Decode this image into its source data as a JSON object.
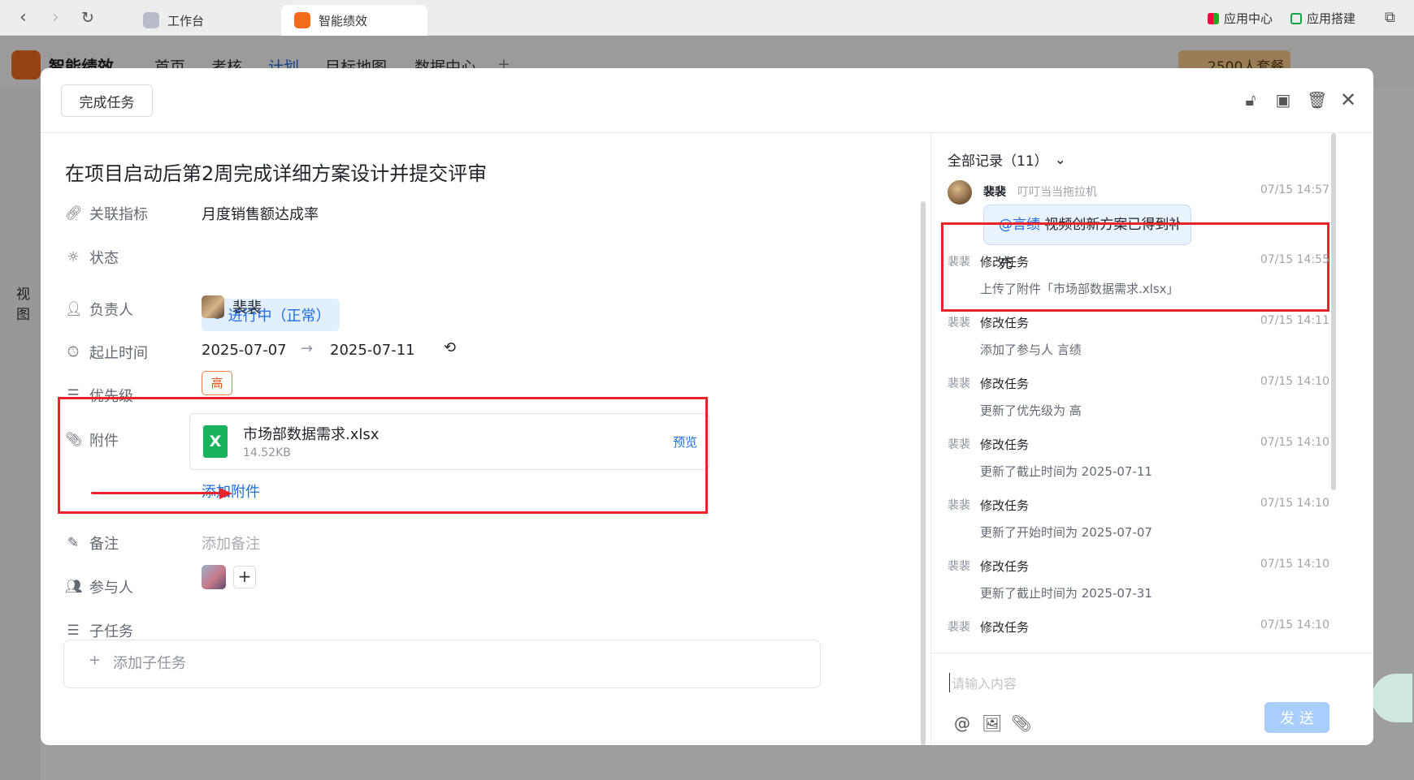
{
  "browser": {
    "tabs": [
      {
        "label": "工作台"
      },
      {
        "label": "智能绩效"
      }
    ],
    "right_items": [
      {
        "label": "应用中心"
      },
      {
        "label": "应用搭建"
      }
    ]
  },
  "app": {
    "name": "智能绩效",
    "nav": [
      "首页",
      "考核",
      "计划",
      "目标地图",
      "数据中心"
    ],
    "plan_label": "2500人套餐",
    "sidebar_text": "视图"
  },
  "modal": {
    "finish_button": "完成任务",
    "title": "在项目启动后第2周完成详细方案设计并提交评审",
    "fields": {
      "metric": {
        "label": "关联指标",
        "value": "月度销售额达成率"
      },
      "status": {
        "label": "状态",
        "value": "进行中（正常）"
      },
      "owner": {
        "label": "负责人",
        "value": "裴裴"
      },
      "time": {
        "label": "起止时间",
        "start": "2025-07-07",
        "end": "2025-07-11"
      },
      "priority": {
        "label": "优先级",
        "value": "高"
      },
      "attachment": {
        "label": "附件",
        "file_name": "市场部数据需求.xlsx",
        "file_size": "14.52KB",
        "file_icon": "X",
        "preview_label": "预览",
        "add_label": "添加附件"
      },
      "note": {
        "label": "备注",
        "placeholder": "添加备注"
      },
      "participants": {
        "label": "参与人",
        "add": "+"
      },
      "subtasks": {
        "label": "子任务",
        "add_label": "添加子任务"
      }
    }
  },
  "records": {
    "header": "全部记录（11）",
    "comment": {
      "name": "裴裴",
      "subtitle": "叮叮当当拖拉机",
      "time": "07/15 14:57",
      "mention": "@言绩",
      "text": " 视频创新方案已得到补充"
    },
    "items": [
      {
        "who": "裴裴",
        "action": "修改任务",
        "time": "07/15 14:55",
        "detail": "上传了附件「市场部数据需求.xlsx」"
      },
      {
        "who": "裴裴",
        "action": "修改任务",
        "time": "07/15 14:11",
        "detail": "添加了参与人 言绩"
      },
      {
        "who": "裴裴",
        "action": "修改任务",
        "time": "07/15 14:10",
        "detail": "更新了优先级为 高"
      },
      {
        "who": "裴裴",
        "action": "修改任务",
        "time": "07/15 14:10",
        "detail": "更新了截止时间为 2025-07-11"
      },
      {
        "who": "裴裴",
        "action": "修改任务",
        "time": "07/15 14:10",
        "detail": "更新了开始时间为 2025-07-07"
      },
      {
        "who": "裴裴",
        "action": "修改任务",
        "time": "07/15 14:10",
        "detail": "更新了截止时间为 2025-07-31"
      },
      {
        "who": "裴裴",
        "action": "修改任务",
        "time": "07/15 14:10",
        "detail": ""
      }
    ],
    "input_placeholder": "请输入内容",
    "send_label": "发 送"
  },
  "colors": {
    "accent": "#1f6fe0",
    "highlight": "#e8242a",
    "priority": "#e2551c",
    "excel": "#18b25a"
  }
}
